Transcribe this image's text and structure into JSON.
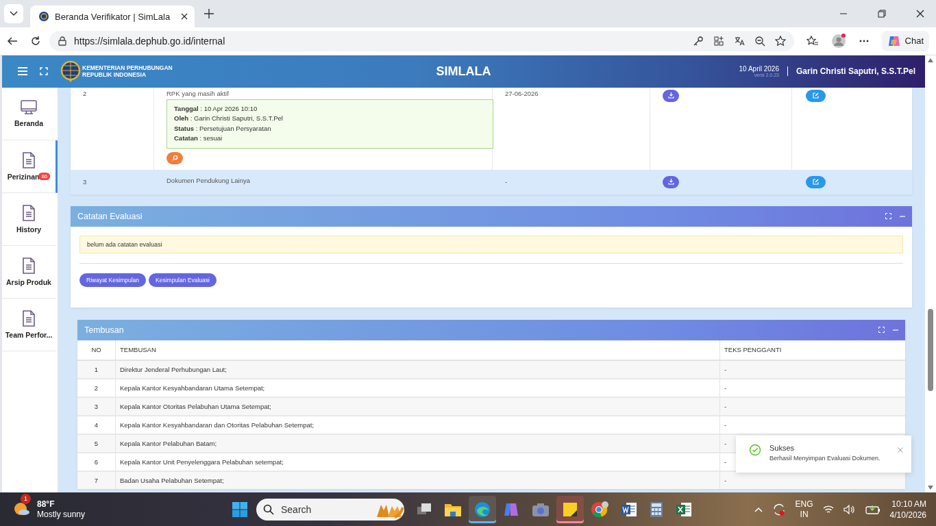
{
  "browser": {
    "tab_title": "Beranda Verifikator | SimLala",
    "url": "https://simlala.dephub.go.id/internal",
    "chat_label": "Chat"
  },
  "header": {
    "org_line1": "KEMENTERIAN PERHUBUNGAN",
    "org_line2": "REPUBLIK INDONESIA",
    "app_title": "SIMLALA",
    "date": "10 April 2026",
    "version": "versi 2.0.23",
    "user": "Garin Christi Saputri, S.S.T.Pel"
  },
  "sidebar": {
    "items": [
      {
        "label": "Beranda",
        "kind": "monitor",
        "selected": false
      },
      {
        "label": "Perizinan",
        "kind": "document",
        "badge": "86",
        "selected": true
      },
      {
        "label": "History",
        "kind": "document",
        "selected": false
      },
      {
        "label": "Arsip Produk",
        "kind": "document",
        "selected": false
      },
      {
        "label": "Team Perfor...",
        "kind": "document",
        "selected": false
      }
    ]
  },
  "documents": {
    "rows": [
      {
        "no": "2",
        "name": "RPK yang masih aktif",
        "note": [
          "**Tanggal** : 10 Apr 2026 10:10",
          "**Oleh** : Garin Christi Saputri, S.S.T.Pel",
          "**Status** : Persetujuan Persyaratan",
          "**Catatan** : sesuai"
        ],
        "date": "27-06-2026",
        "highlighted": false
      },
      {
        "no": "3",
        "name": "Dokumen Pendukung Lainya",
        "date": "-",
        "highlighted": true
      }
    ]
  },
  "evaluation": {
    "title": "Catatan Evaluasi",
    "note": "belum ada catatan evaluasi",
    "buttons": [
      "Riwayat Kesimpulan",
      "Kesimpulan Evaluasi"
    ]
  },
  "tembusan": {
    "title": "Tembusan",
    "columns": [
      "NO",
      "TEMBUSAN",
      "TEKS PENGGANTI"
    ],
    "rows": [
      {
        "no": "1",
        "tembusan": "Direktur Jenderal Perhubungan Laut;",
        "teks": "-"
      },
      {
        "no": "2",
        "tembusan": "Kepala Kantor Kesyahbandaran Utama Setempat;",
        "teks": "-"
      },
      {
        "no": "3",
        "tembusan": "Kepala Kantor Otoritas Pelabuhan Utama Setempat;",
        "teks": "-"
      },
      {
        "no": "4",
        "tembusan": "Kepala Kantor Kesyahbandaran dan Otoritas Pelabuhan Setempat;",
        "teks": "-"
      },
      {
        "no": "5",
        "tembusan": "Kepala Kantor Pelabuhan Batam;",
        "teks": "-"
      },
      {
        "no": "6",
        "tembusan": "Kepala Kantor Unit Penyelenggara Pelabuhan setempat;",
        "teks": "-"
      },
      {
        "no": "7",
        "tembusan": "Badan Usaha Pelabuhan Setempat;",
        "teks": "-"
      }
    ]
  },
  "toast": {
    "title": "Sukses",
    "message": "Berhasil Menyimpan Evaluasi Dokumen."
  },
  "taskbar": {
    "weather_badge": "1",
    "temperature": "88°F",
    "weather": "Mostly sunny",
    "search_placeholder": "Search",
    "language": "ENG",
    "region": "IN",
    "time": "10:10 AM",
    "date": "4/10/2026"
  }
}
